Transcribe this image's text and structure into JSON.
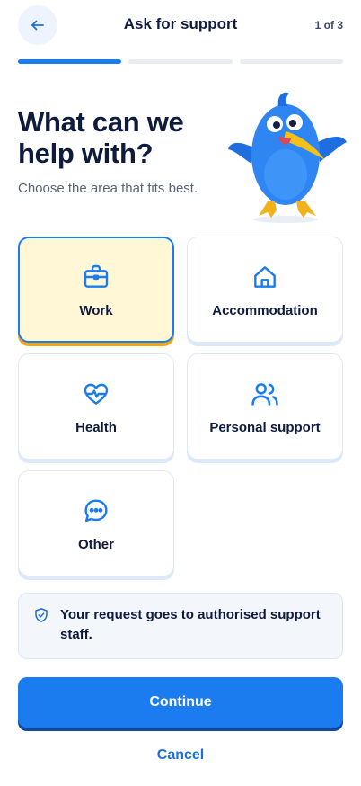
{
  "header": {
    "title": "Ask for support",
    "step": "1 of 3",
    "back_icon": "arrow-left-icon"
  },
  "progress": {
    "total_steps": 3,
    "current_step": 1
  },
  "hero": {
    "title": "What can we help with?",
    "subtitle": "Choose the area that fits best.",
    "mascot": "blue-bird-mascot"
  },
  "options": [
    {
      "label": "Work",
      "icon": "briefcase-icon",
      "selected": true
    },
    {
      "label": "Accommodation",
      "icon": "house-icon",
      "selected": false
    },
    {
      "label": "Health",
      "icon": "heart-pulse-icon",
      "selected": false
    },
    {
      "label": "Personal support",
      "icon": "users-icon",
      "selected": false
    },
    {
      "label": "Other",
      "icon": "chat-bubble-icon",
      "selected": false
    }
  ],
  "notice": {
    "text": "Your request goes to authorised support staff.",
    "icon": "shield-check-icon"
  },
  "actions": {
    "continue_label": "Continue",
    "cancel_label": "Cancel"
  },
  "colors": {
    "primary": "#1b7cf0",
    "selected_bg": "#fff7d6",
    "selected_accent": "#f2a71b",
    "text": "#0f1b3d"
  }
}
